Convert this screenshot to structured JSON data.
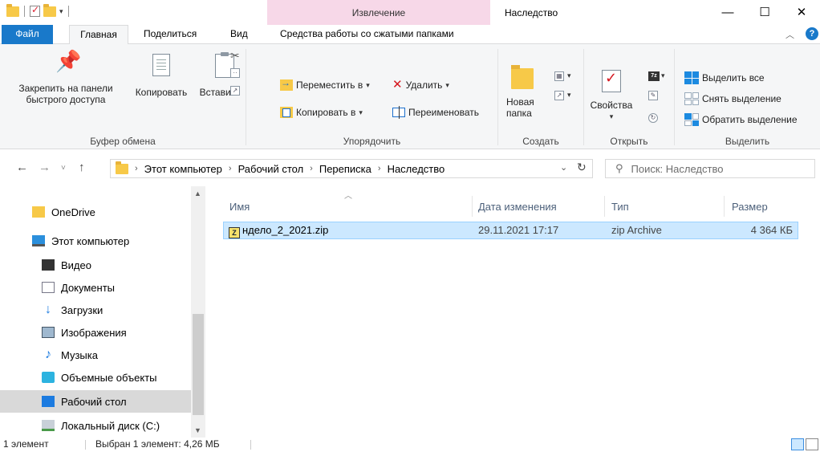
{
  "window": {
    "title": "Наследство",
    "context_tab_header": "Извлечение",
    "minimize": "—",
    "maximize": "☐",
    "close": "✕"
  },
  "ribbon_tabs": {
    "file": "Файл",
    "home": "Главная",
    "share": "Поделиться",
    "view": "Вид",
    "compressed_tools": "Средства работы со сжатыми папками"
  },
  "ribbon": {
    "clipboard": {
      "pin_label_1": "Закрепить на панели",
      "pin_label_2": "быстрого доступа",
      "copy": "Копировать",
      "paste": "Вставить",
      "group": "Буфер обмена"
    },
    "organize": {
      "move_to": "Переместить в",
      "copy_to": "Копировать в",
      "delete": "Удалить",
      "rename": "Переименовать",
      "group": "Упорядочить"
    },
    "new": {
      "new_folder_1": "Новая",
      "new_folder_2": "папка",
      "group": "Создать"
    },
    "open": {
      "properties": "Свойства",
      "group": "Открыть"
    },
    "select": {
      "select_all": "Выделить все",
      "select_none": "Снять выделение",
      "invert": "Обратить выделение",
      "group": "Выделить"
    }
  },
  "address": {
    "crumbs": [
      "Этот компьютер",
      "Рабочий стол",
      "Переписка",
      "Наследство"
    ],
    "search_placeholder": "Поиск: Наследство"
  },
  "nav_pane": {
    "items": [
      {
        "label": "OneDrive",
        "icon": "folder-icon"
      },
      {
        "label": "Этот компьютер",
        "icon": "computer-icon"
      },
      {
        "label": "Видео",
        "icon": "video-icon"
      },
      {
        "label": "Документы",
        "icon": "documents-icon"
      },
      {
        "label": "Загрузки",
        "icon": "downloads-icon"
      },
      {
        "label": "Изображения",
        "icon": "pictures-icon"
      },
      {
        "label": "Музыка",
        "icon": "music-icon"
      },
      {
        "label": "Объемные объекты",
        "icon": "3d-objects-icon"
      },
      {
        "label": "Рабочий стол",
        "icon": "desktop-icon"
      },
      {
        "label": "Локальный диск (C:)",
        "icon": "disk-icon"
      }
    ]
  },
  "file_list": {
    "columns": [
      "Имя",
      "Дата изменения",
      "Тип",
      "Размер"
    ],
    "rows": [
      {
        "name": "ндело_2_2021.zip",
        "modified": "29.11.2021 17:17",
        "type": "zip Archive",
        "size": "4 364 КБ"
      }
    ]
  },
  "status": {
    "count": "1 элемент",
    "selected": "Выбран 1 элемент: 4,26 МБ"
  },
  "colors": {
    "accent": "#1979ca",
    "context_tab": "#f7d8e8",
    "selection": "#cce8ff"
  }
}
